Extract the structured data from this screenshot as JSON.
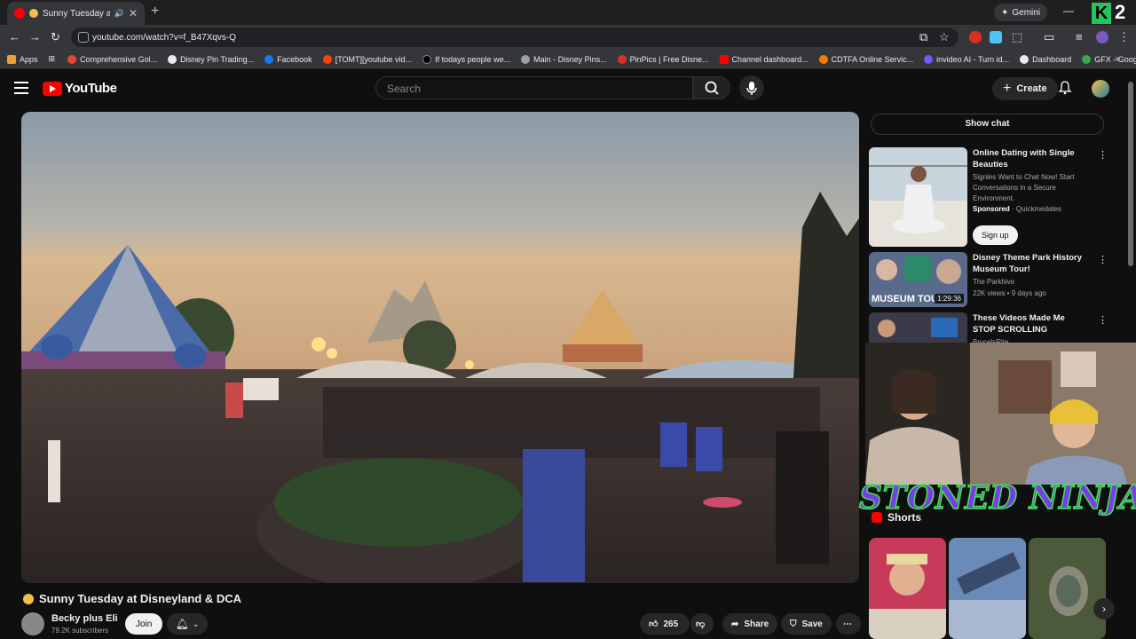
{
  "browser": {
    "tab_title": "Sunny Tuesday at Disne",
    "url": "youtube.com/watch?v=f_B47Xqvs-Q",
    "gemini_label": "Gemini",
    "k_number": "2",
    "bookmarks": [
      {
        "label": "Apps",
        "color": "#e8eaed"
      },
      {
        "label": "Comprehensive Gol...",
        "color": "#ea4335"
      },
      {
        "label": "Disney Pin Trading...",
        "color": "#e8eaed"
      },
      {
        "label": "Facebook",
        "color": "#1877f2"
      },
      {
        "label": "[TOMT][youtube vid...",
        "color": "#ff4500"
      },
      {
        "label": "If todays people we...",
        "color": "#000000"
      },
      {
        "label": "Main - Disney Pins...",
        "color": "#9aa0a6"
      },
      {
        "label": "PinPics | Free Disne...",
        "color": "#d93025"
      },
      {
        "label": "Channel dashboard...",
        "color": "#ff0000"
      },
      {
        "label": "CDTFA Online Servic...",
        "color": "#f57c00"
      },
      {
        "label": "invideo AI - Turn id...",
        "color": "#6f5cf6"
      },
      {
        "label": "Dashboard",
        "color": "#e8eaed"
      },
      {
        "label": "GFX - Google Drive",
        "color": "#34a853"
      }
    ]
  },
  "youtube": {
    "logo_text": "YouTube",
    "search_placeholder": "Search",
    "create_label": "Create",
    "video": {
      "title": "Sunny Tuesday at Disneyland & DCA",
      "channel": "Becky plus Eli",
      "subscribers": "79.2K subscribers",
      "join_label": "Join",
      "likes": "265",
      "share_label": "Share",
      "save_label": "Save"
    },
    "sidebar": {
      "show_chat": "Show chat",
      "items": [
        {
          "title": "Online Dating with Single Beauties",
          "desc": "Signles Want to Chat Now! Start Conversations in a Secure Environment.",
          "sponsored": "Sponsored",
          "advertiser": "Quickmedates",
          "cta": "Sign up"
        },
        {
          "title": "Disney Theme Park History Museum Tour!",
          "channel": "The Parkhive",
          "meta": "22K views • 9 days ago",
          "duration": "1:29:36",
          "thumb_text": "MUSEUM TOUR"
        },
        {
          "title": "These Videos Made Me STOP SCROLLING",
          "channel": "BrycelsRite"
        }
      ],
      "shorts_label": "Shorts"
    }
  },
  "overlay": {
    "stream_title": "STONED NINJA"
  },
  "colors": {
    "bg": "#0f0f0f",
    "accent": "#ff0000",
    "overlay_fill": "#7c3aed",
    "overlay_stroke": "#3ee84b"
  }
}
